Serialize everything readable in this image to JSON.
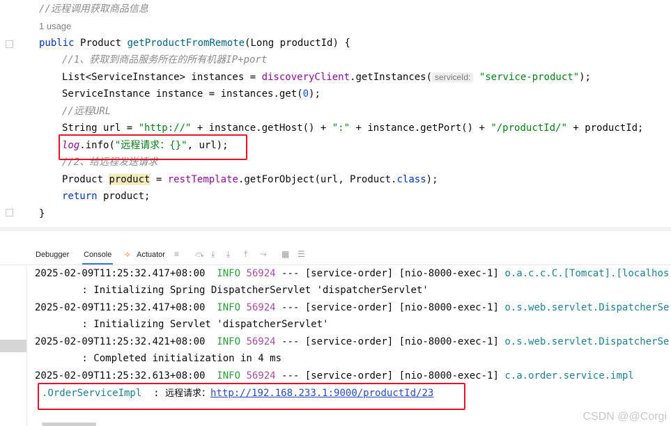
{
  "editor": {
    "comment_title": "//远程调用获取商品信息",
    "usage_hint": "1 usage",
    "signature": {
      "kw_public": "public",
      "ret_type": "Product",
      "method_name": "getProductFromRemote",
      "params": "(Long productId) {"
    },
    "comment_1": "//1、获取到商品服务所在的所有机器IP+port",
    "line_instances": {
      "p1": "List<ServiceInstance> instances = ",
      "field": "discoveryClient",
      "p2": ".getInstances(",
      "hint": "serviceId:",
      "str": "\"service-product\"",
      "p3": ");"
    },
    "line_instance": {
      "p1": "ServiceInstance instance = instances.get(",
      "num": "0",
      "p2": ");"
    },
    "comment_url": "//远程URL",
    "line_url": {
      "p1": "String url = ",
      "s1": "\"http://\"",
      "p2": " + instance.getHost() + ",
      "s2": "\":\"",
      "p3": " + instance.getPort() + ",
      "s3": "\"/productId/\"",
      "p4": " + productId;"
    },
    "line_log": {
      "log": "log",
      "p1": ".info(",
      "str": "\"远程请求：{}\"",
      "p2": ", url);"
    },
    "comment_2": "//2、给远程发送请求",
    "line_product": {
      "p1": "Product ",
      "var": "product",
      "p2": " = ",
      "field": "restTemplate",
      "p3": ".getForObject(url, Product.",
      "kw": "class",
      "p4": ");"
    },
    "line_return": {
      "kw": "return",
      "p1": " product;"
    },
    "closing": "}"
  },
  "toolbar": {
    "debugger": "Debugger",
    "console": "Console",
    "actuator": "Actuator"
  },
  "console": {
    "lines": [
      {
        "ts": "2025-02-09T11:25:32.417+08:00",
        "level": "INFO",
        "pid": "56924",
        "mid": " --- [service-order] [nio-8000-exec-1] ",
        "logger": "o.a.c.c.C.[Tomcat].[localhos"
      },
      {
        "msg": "        : Initializing Spring DispatcherServlet 'dispatcherServlet'"
      },
      {
        "ts": "2025-02-09T11:25:32.417+08:00",
        "level": "INFO",
        "pid": "56924",
        "mid": " --- [service-order] [nio-8000-exec-1] ",
        "logger": "o.s.web.servlet.DispatcherSe"
      },
      {
        "msg": "        : Initializing Servlet 'dispatcherServlet'"
      },
      {
        "ts": "2025-02-09T11:25:32.421+08:00",
        "level": "INFO",
        "pid": "56924",
        "mid": " --- [service-order] [nio-8000-exec-1] ",
        "logger": "o.s.web.servlet.DispatcherSe"
      },
      {
        "msg": "        : Completed initialization in 4 ms"
      },
      {
        "ts": "2025-02-09T11:25:32.613+08:00",
        "level": "INFO",
        "pid": "56924",
        "mid": " --- [service-order] [nio-8000-exec-1] ",
        "logger": "c.a.order.service.impl"
      }
    ],
    "last": {
      "logger": ".OrderServiceImpl",
      "sep": "  : ",
      "label": "远程请求：",
      "url": "http://192.168.233.1:9000/productId/23"
    }
  },
  "watermark": "CSDN @@Corgi",
  "colors": {
    "highlight_box": "#e8112d",
    "info": "#2a9d3a",
    "logger": "#21808f"
  }
}
